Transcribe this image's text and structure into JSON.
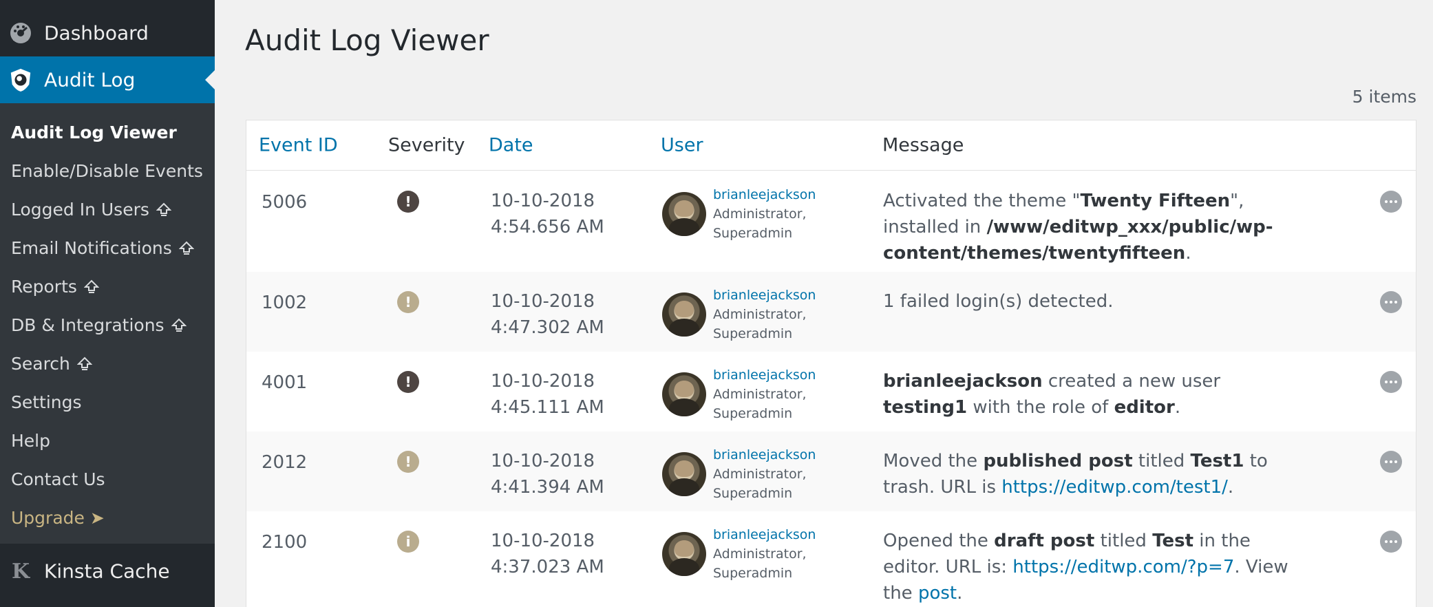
{
  "sidebar": {
    "dashboard_label": "Dashboard",
    "audit_log_label": "Audit Log",
    "submenu": [
      {
        "label": "Audit Log Viewer",
        "premium": false
      },
      {
        "label": "Enable/Disable Events",
        "premium": false
      },
      {
        "label": "Logged In Users",
        "premium": true
      },
      {
        "label": "Email Notifications",
        "premium": true
      },
      {
        "label": "Reports",
        "premium": true
      },
      {
        "label": "DB & Integrations",
        "premium": true
      },
      {
        "label": "Search",
        "premium": true
      },
      {
        "label": "Settings",
        "premium": false
      },
      {
        "label": "Help",
        "premium": false
      },
      {
        "label": "Contact Us",
        "premium": false
      },
      {
        "label": "Upgrade ➤",
        "premium": false
      }
    ],
    "kinsta_label": "Kinsta Cache",
    "kinsta_icon_letter": "K"
  },
  "main": {
    "title": "Audit Log Viewer",
    "items_count": "5 items"
  },
  "table": {
    "columns": {
      "event_id": "Event ID",
      "severity": "Severity",
      "date": "Date",
      "user": "User",
      "message": "Message"
    },
    "rows": [
      {
        "id": "5006",
        "severity": "critical",
        "severity_glyph": "!",
        "date": "10-10-2018",
        "time": "4:54.656 AM",
        "username": "brianleejackson",
        "role1": "Administrator,",
        "role2": "Superadmin",
        "msg": {
          "p1": "Activated the theme \"",
          "b1": "Twenty Fifteen",
          "p2": "\", installed in ",
          "b2": "/www/editwp_xxx/public/wp-content/themes/twentyfifteen",
          "p3": "."
        }
      },
      {
        "id": "1002",
        "severity": "warning",
        "severity_glyph": "!",
        "date": "10-10-2018",
        "time": "4:47.302 AM",
        "username": "brianleejackson",
        "role1": "Administrator,",
        "role2": "Superadmin",
        "msg": {
          "p1": "1 failed login(s) detected."
        }
      },
      {
        "id": "4001",
        "severity": "critical",
        "severity_glyph": "!",
        "date": "10-10-2018",
        "time": "4:45.111 AM",
        "username": "brianleejackson",
        "role1": "Administrator,",
        "role2": "Superadmin",
        "msg": {
          "b1": "brianleejackson",
          "p1": " created a new user ",
          "b2": "testing1",
          "p2": " with the role of ",
          "b3": "editor",
          "p3": "."
        }
      },
      {
        "id": "2012",
        "severity": "warning",
        "severity_glyph": "!",
        "date": "10-10-2018",
        "time": "4:41.394 AM",
        "username": "brianleejackson",
        "role1": "Administrator,",
        "role2": "Superadmin",
        "msg": {
          "p1": "Moved the ",
          "b1": "published post",
          "p2": " titled ",
          "b2": "Test1",
          "p3": " to trash. URL is ",
          "link": "https://editwp.com/test1/",
          "p4": "."
        }
      },
      {
        "id": "2100",
        "severity": "info",
        "severity_glyph": "i",
        "date": "10-10-2018",
        "time": "4:37.023 AM",
        "username": "brianleejackson",
        "role1": "Administrator,",
        "role2": "Superadmin",
        "msg": {
          "p1": "Opened the ",
          "b1": "draft post",
          "p2": " titled ",
          "b2": "Test",
          "p3": " in the editor. URL is: ",
          "link1": "https://editwp.com/?p=7",
          "p4": ". View the ",
          "link2": "post",
          "p5": "."
        }
      }
    ]
  },
  "colors": {
    "sidebar_bg": "#23282d",
    "submenu_bg": "#32373c",
    "accent": "#0073aa",
    "severity_critical": "#4e4542",
    "severity_warning": "#b9ac8e",
    "severity_info": "#b9ac8e"
  },
  "icons": {
    "dashboard": "dashboard-gauge-icon",
    "audit_log": "audit-log-shield-icon",
    "premium": "upgrade-arrow-icon",
    "kinsta": "kinsta-k-icon",
    "more": "more-options-icon"
  }
}
